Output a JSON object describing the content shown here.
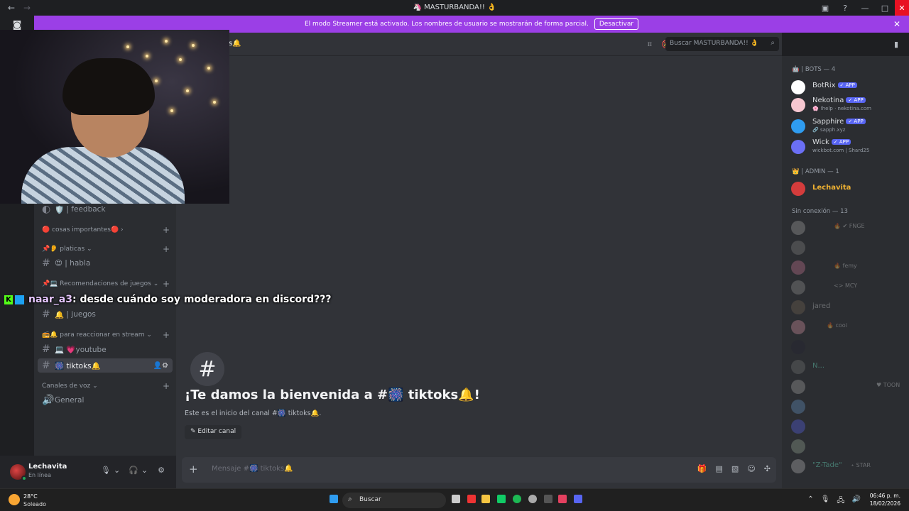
{
  "window": {
    "title": "🦄 MASTURBANDA!! 👌",
    "back": "←",
    "forward": "→",
    "inbox_icon": "inbox-icon",
    "help_icon": "?",
    "minimize": "—",
    "maximize": "□",
    "close": "✕"
  },
  "banner": {
    "text": "El modo Streamer está activado. Los nombres de usuario se mostrarán de forma parcial.",
    "button": "Desactivar",
    "close": "✕"
  },
  "rail": {
    "discord_glyph": "◙"
  },
  "sidebar": {
    "items": [
      {
        "kind": "channel",
        "icon": "🛡️",
        "label": "| feedback",
        "hash": "◐"
      },
      {
        "kind": "category",
        "label": "🔴 cosas importantes🔴 ›"
      },
      {
        "kind": "category",
        "label": "📌👂 platicas ⌄"
      },
      {
        "kind": "channel",
        "icon": "😍",
        "label": "| habla",
        "hash": "#"
      },
      {
        "kind": "category",
        "label": "📌💻 Recomendaciones de juegos ⌄"
      },
      {
        "kind": "channel",
        "icon": "🔔",
        "label": "| juegos",
        "hash": "#"
      },
      {
        "kind": "category",
        "label": "📻🔔 para reaccionar en stream ⌄"
      },
      {
        "kind": "channel",
        "icon": "💻",
        "label": "💗youtube",
        "hash": "#"
      },
      {
        "kind": "channel",
        "icon": "🎆",
        "label": "tiktoks🔔",
        "hash": "#"
      },
      {
        "kind": "category",
        "label": "Canales de voz ⌄"
      },
      {
        "kind": "voice",
        "icon": "🔊",
        "label": "General"
      }
    ],
    "plus": "+"
  },
  "user": {
    "name": "Lechavita",
    "status": "En línea",
    "mic_icon": "🎙",
    "headset_icon": "🎧",
    "settings_icon": "⚙"
  },
  "chat": {
    "header_tail": "s🔔",
    "search_placeholder": "Buscar MASTURBANDA!! 👌",
    "hash_glyph": "#",
    "welcome": "¡Te damos la bienvenida a #🎆 tiktoks🔔!",
    "start": "Este es el inicio del canal #🎆 tiktoks🔔.",
    "edit_button": "✎ Editar canal",
    "composer_placeholder": "Mensaje #🎆 tiktoks🔔",
    "plus": "+"
  },
  "members": {
    "group_bots": "🤖 | BOTS — 4",
    "group_admin": "👑 | ADMIN — 1",
    "group_offline": "Sin conexión — 13",
    "app_badge": "✓ APP",
    "bots": [
      {
        "name": "BotRix",
        "sub": "",
        "color": "#ffffff"
      },
      {
        "name": "Nekotina",
        "sub": "🌸 !help · nekotina.com",
        "color": "#f7c7d1"
      },
      {
        "name": "Sapphire",
        "sub": "🔗 sapph.xyz",
        "color": "#2f9cf0"
      },
      {
        "name": "Wick",
        "sub": "wickbot.com | Shard25",
        "color": "#6b6ff5"
      }
    ],
    "admin": {
      "name": "Lechavita",
      "color": "#d43c3c"
    },
    "offline": [
      {
        "name": "",
        "tag": "🔥 ✔ FNGE"
      },
      {
        "name": "",
        "tag": ""
      },
      {
        "name": "",
        "tag": "🔥 femy"
      },
      {
        "name": "",
        "tag": "<> MCY"
      },
      {
        "name": "jared",
        "tag": ""
      },
      {
        "name": "",
        "tag": "🔥 cooi"
      },
      {
        "name": "",
        "tag": ""
      },
      {
        "name": "N...",
        "tag": ""
      },
      {
        "name": "",
        "tag": "♥ TOON"
      },
      {
        "name": "",
        "tag": ""
      },
      {
        "name": "",
        "tag": ""
      },
      {
        "name": "",
        "tag": ""
      },
      {
        "name": "\"Z-Tade\"",
        "tag": "⋆ STAR"
      }
    ]
  },
  "overlay": {
    "k": "K",
    "user": "naar_a3",
    "message": ": desde cuándo soy moderadora en discord???"
  },
  "taskbar": {
    "temp": "28°C",
    "weather": "Soleado",
    "search": "Buscar",
    "time": "06:46 p. m.",
    "date": "18/02/2026",
    "tray": [
      "⌃",
      "🎙",
      "🖧",
      "🔊"
    ]
  },
  "colors": {
    "accent": "#5865f2",
    "banner": "#9b3fe6",
    "online": "#23a55a"
  }
}
